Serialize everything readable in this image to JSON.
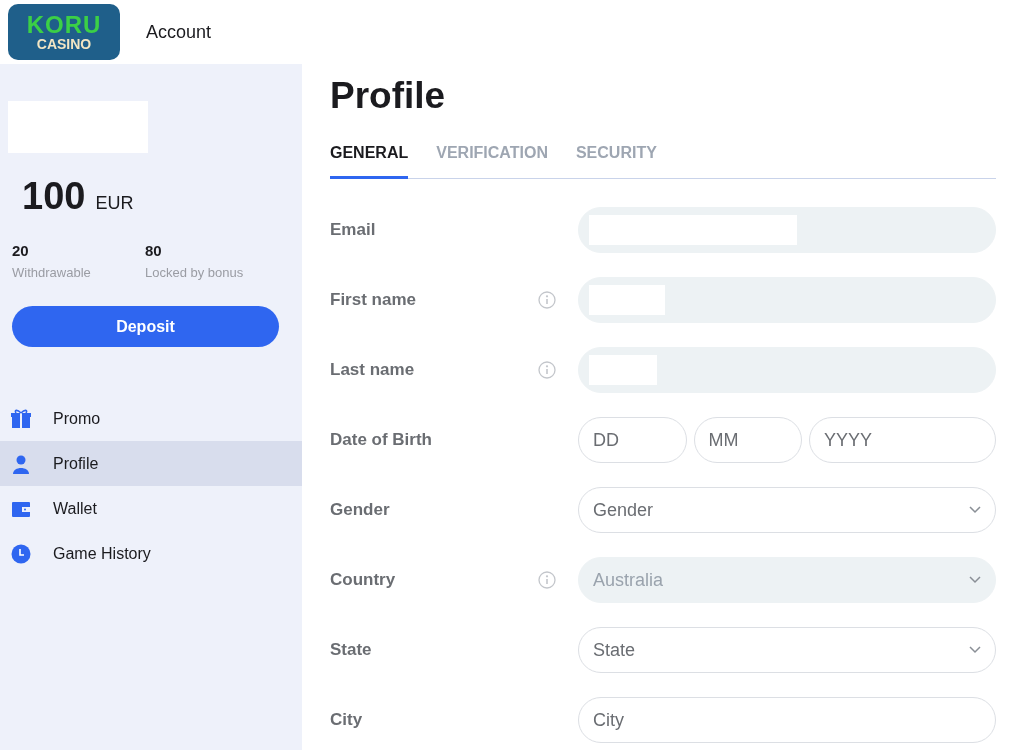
{
  "header": {
    "logo": {
      "line_1": "KORU",
      "line_2": "CASINO"
    },
    "title": "Account"
  },
  "sidebar": {
    "balance": {
      "amount": "100",
      "currency": "EUR"
    },
    "sub_balances": [
      {
        "value": "20",
        "label": "Withdrawable"
      },
      {
        "value": "80",
        "label": "Locked by bonus"
      }
    ],
    "deposit_button": "Deposit",
    "items": [
      {
        "label": "Promo",
        "selected": false
      },
      {
        "label": "Profile",
        "selected": true
      },
      {
        "label": "Wallet",
        "selected": false
      },
      {
        "label": "Game History",
        "selected": false
      }
    ]
  },
  "page_title": "Profile",
  "tabs": [
    {
      "label": "GENERAL",
      "selected": true
    },
    {
      "label": "VERIFICATION",
      "selected": false
    },
    {
      "label": "SECURITY",
      "selected": false
    }
  ],
  "fields": [
    {
      "label": "Email",
      "kind": "redacted",
      "info": false,
      "disabled": true
    },
    {
      "label": "First name",
      "kind": "redacted",
      "info": true,
      "disabled": true
    },
    {
      "label": "Last name",
      "kind": "redacted",
      "info": true,
      "disabled": true
    },
    {
      "label": "Date of Birth",
      "kind": "date",
      "info": false,
      "disabled": false,
      "placeholders": [
        "DD",
        "MM",
        "YYYY"
      ]
    },
    {
      "label": "Gender",
      "kind": "select",
      "info": false,
      "disabled": false,
      "placeholder": "Gender"
    },
    {
      "label": "Country",
      "kind": "select",
      "info": true,
      "disabled": true,
      "value": "Australia"
    },
    {
      "label": "State",
      "kind": "select",
      "info": false,
      "disabled": false,
      "placeholder": "State"
    },
    {
      "label": "City",
      "kind": "text",
      "info": false,
      "disabled": false,
      "placeholder": "City"
    }
  ]
}
